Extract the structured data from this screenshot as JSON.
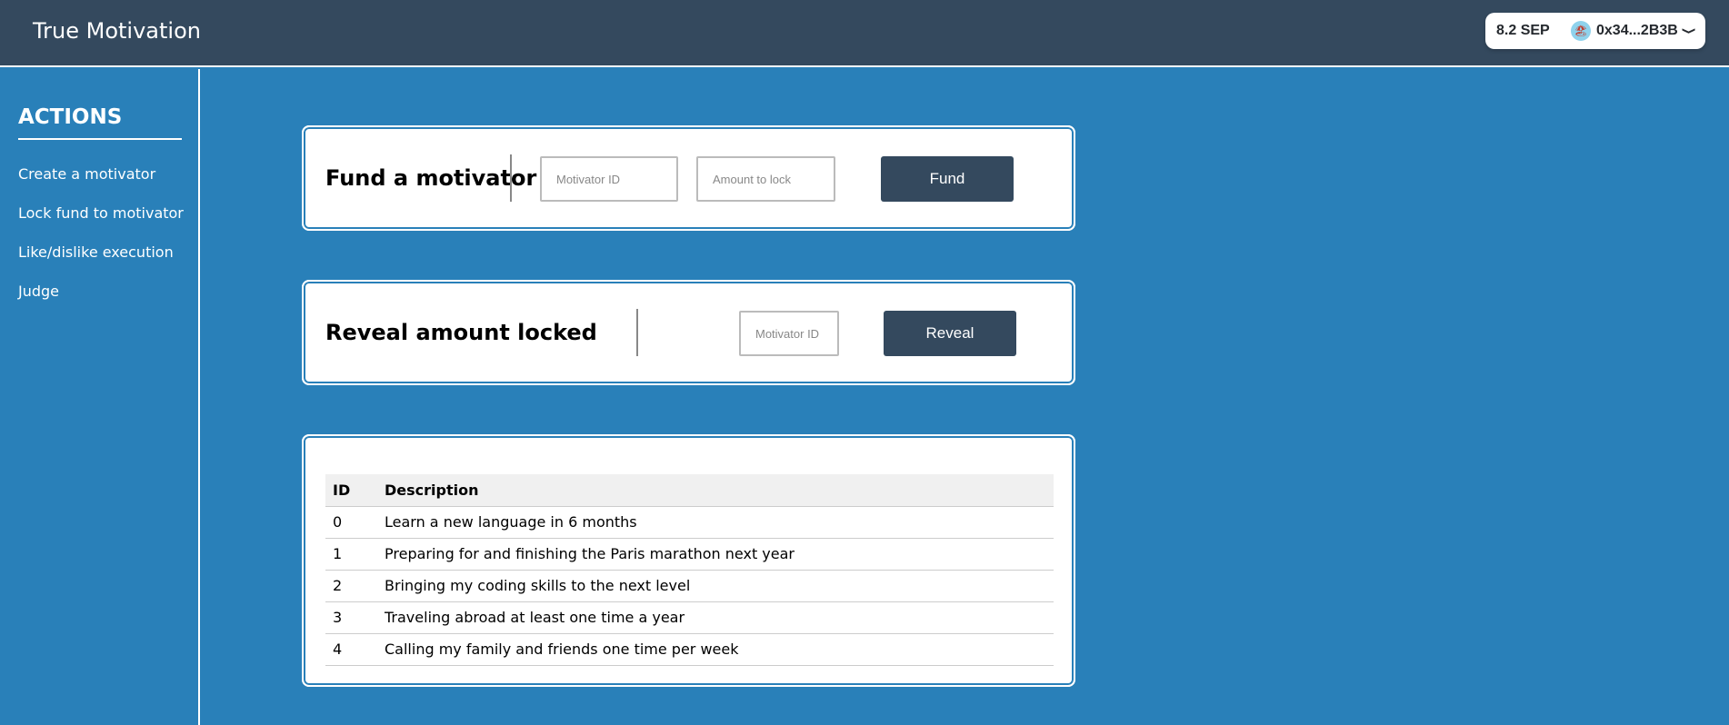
{
  "header": {
    "title": "True Motivation",
    "wallet": {
      "balance": "8.2 SEP",
      "avatar_icon": "🏖",
      "address": "0x34...2B3B",
      "chevron": "❯"
    }
  },
  "sidebar": {
    "heading": "ACTIONS",
    "items": [
      {
        "label": "Create a motivator"
      },
      {
        "label": "Lock fund to motivator"
      },
      {
        "label": "Like/dislike execution"
      },
      {
        "label": "Judge"
      }
    ]
  },
  "fund": {
    "title": "Fund a motivator",
    "motivator_id_placeholder": "Motivator ID",
    "amount_placeholder": "Amount to lock",
    "button_label": "Fund"
  },
  "reveal": {
    "title": "Reveal amount locked",
    "motivator_id_placeholder": "Motivator ID",
    "button_label": "Reveal"
  },
  "motivators": {
    "columns": [
      "ID",
      "Description"
    ],
    "rows": [
      {
        "id": "0",
        "description": "Learn a new language in 6 months"
      },
      {
        "id": "1",
        "description": "Preparing for and finishing the Paris marathon next year"
      },
      {
        "id": "2",
        "description": "Bringing my coding skills to the next level"
      },
      {
        "id": "3",
        "description": "Traveling abroad at least one time a year"
      },
      {
        "id": "4",
        "description": "Calling my family and friends one time per week"
      }
    ]
  },
  "colors": {
    "background": "#2980b9",
    "header": "#34495e",
    "button": "#34495e"
  }
}
